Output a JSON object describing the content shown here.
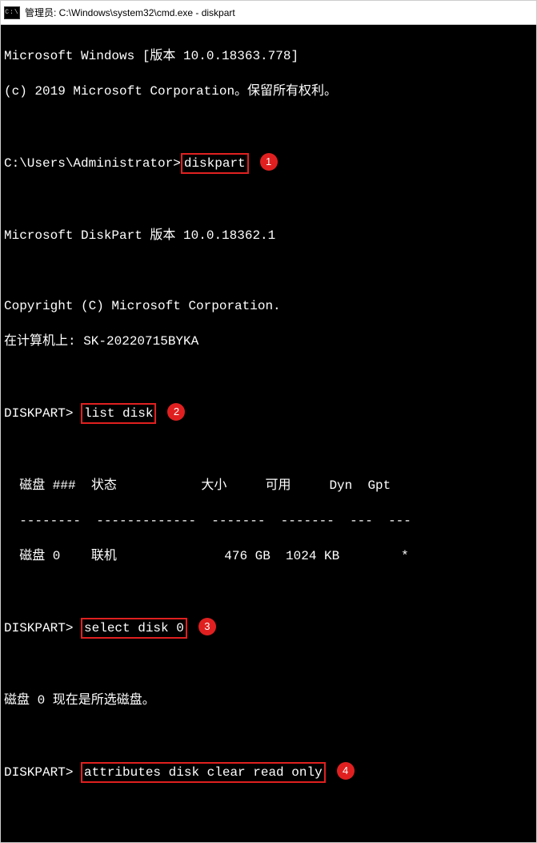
{
  "window": {
    "icon_text": "C:\\",
    "title": "管理员: C:\\Windows\\system32\\cmd.exe - diskpart"
  },
  "lines": {
    "l1": "Microsoft Windows [版本 10.0.18363.778]",
    "l2": "(c) 2019 Microsoft Corporation。保留所有权利。",
    "blank": " ",
    "prompt_user": "C:\\Users\\Administrator>",
    "cmd_diskpart": "diskpart",
    "badge1": "1",
    "diskpart_ver": "Microsoft DiskPart 版本 10.0.18362.1",
    "copyright": "Copyright (C) Microsoft Corporation.",
    "computer": "在计算机上: SK-20220715BYKA",
    "prompt_dp": "DISKPART> ",
    "cmd_listdisk": "list disk",
    "badge2": "2",
    "table_header": "  磁盘 ###  状态           大小     可用     Dyn  Gpt",
    "table_divider": "  --------  -------------  -------  -------  ---  ---",
    "table_row0": "  磁盘 0    联机              476 GB  1024 KB        *",
    "cmd_select": "select disk 0",
    "badge3": "3",
    "selected_msg": "磁盘 0 现在是所选磁盘。",
    "cmd_attr": "attributes disk clear read only",
    "badge4": "4"
  }
}
